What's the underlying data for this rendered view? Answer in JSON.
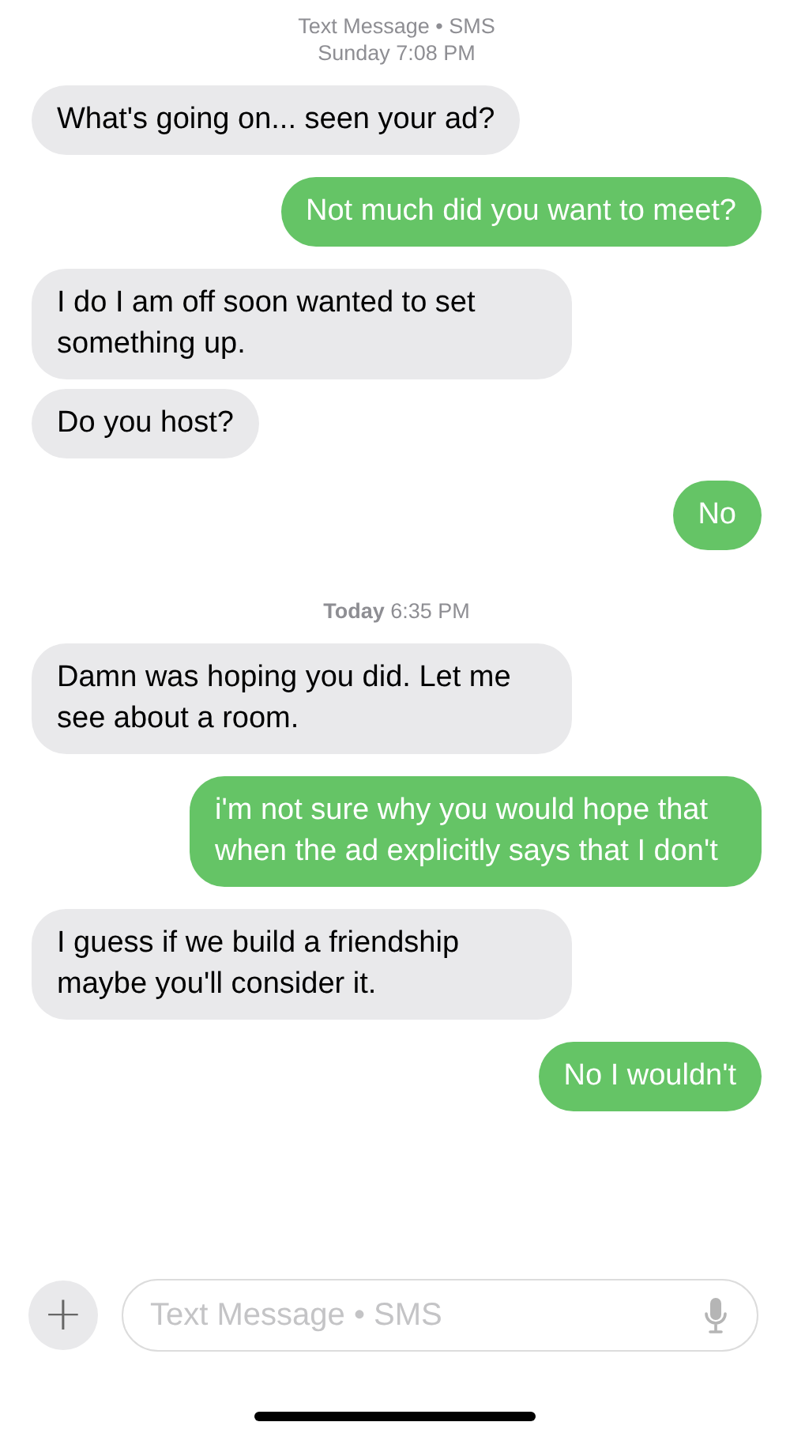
{
  "thread": [
    {
      "kind": "header",
      "service": "Text Message • SMS",
      "time": "Sunday 7:08 PM"
    },
    {
      "kind": "received",
      "text": "What's going on... seen your ad?"
    },
    {
      "kind": "sent",
      "text": "Not much did you want to meet?"
    },
    {
      "kind": "received",
      "text": "I do I am off soon wanted to set something up."
    },
    {
      "kind": "received",
      "text": "Do you host?"
    },
    {
      "kind": "sent",
      "text": "No"
    },
    {
      "kind": "header",
      "time": "**Today** 6:35 PM"
    },
    {
      "kind": "received",
      "text": "Damn was hoping you did. Let me see about a room."
    },
    {
      "kind": "sent",
      "text": "i'm not sure why you would hope that when the ad explicitly says that I don't"
    },
    {
      "kind": "received",
      "text": "I guess if we build a friendship maybe you'll consider it."
    },
    {
      "kind": "sent",
      "text": "No I wouldn't"
    }
  ],
  "composer": {
    "add_button": "+",
    "placeholder": "Text Message • SMS"
  }
}
